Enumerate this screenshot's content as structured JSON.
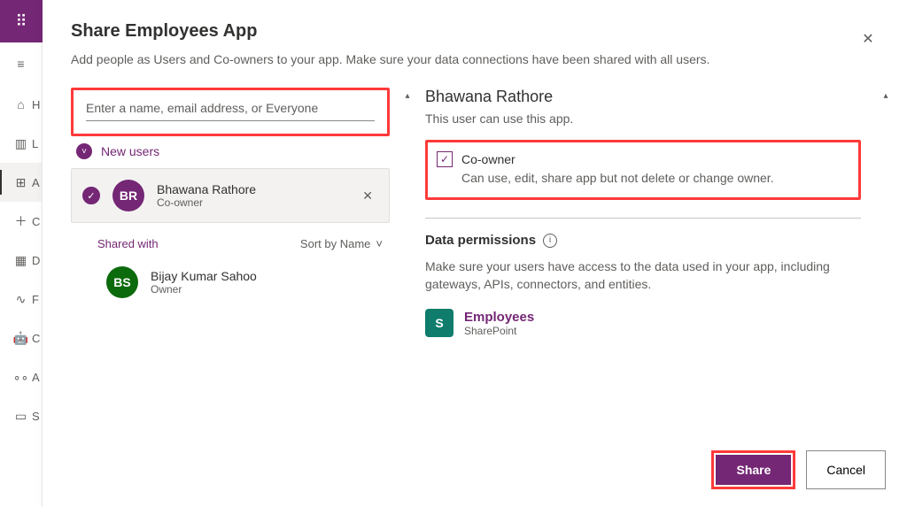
{
  "rail": {
    "items": [
      {
        "icon": "≡",
        "label": ""
      },
      {
        "icon": "⌂",
        "label": "H"
      },
      {
        "icon": "▥",
        "label": "L"
      },
      {
        "icon": "⊞",
        "label": "A"
      },
      {
        "icon": "＋",
        "label": "C"
      },
      {
        "icon": "▦",
        "label": "D"
      },
      {
        "icon": "∿",
        "label": "F"
      },
      {
        "icon": "🤖",
        "label": "C"
      },
      {
        "icon": "∘∘",
        "label": "A"
      },
      {
        "icon": "▭",
        "label": "S"
      }
    ]
  },
  "header": {
    "title": "Share Employees App",
    "subtitle": "Add people as Users and Co-owners to your app. Make sure your data connections have been shared with all users."
  },
  "search": {
    "placeholder": "Enter a name, email address, or Everyone"
  },
  "new_users": {
    "label": "New users",
    "items": [
      {
        "initials": "BR",
        "name": "Bhawana Rathore",
        "role": "Co-owner"
      }
    ]
  },
  "shared": {
    "label": "Shared with",
    "sort": "Sort by Name",
    "items": [
      {
        "initials": "BS",
        "name": "Bijay Kumar Sahoo",
        "role": "Owner"
      }
    ]
  },
  "details": {
    "name": "Bhawana Rathore",
    "subtitle": "This user can use this app.",
    "coowner_label": "Co-owner",
    "coowner_desc": "Can use, edit, share app but not delete or change owner.",
    "perm_title": "Data permissions",
    "perm_desc": "Make sure your users have access to the data used in your app, including gateways, APIs, connectors, and entities.",
    "connection": {
      "name": "Employees",
      "type": "SharePoint"
    }
  },
  "footer": {
    "share": "Share",
    "cancel": "Cancel"
  }
}
